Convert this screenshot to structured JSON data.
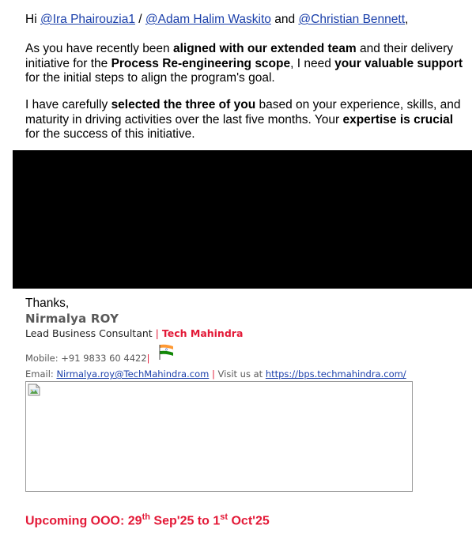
{
  "greeting": {
    "hi": "Hi",
    "mention1": "@Ira Phairouzia1",
    "slash": "/",
    "mention2": "@Adam Halim Waskito",
    "and": "and",
    "mention3": "@Christian Bennett",
    "comma": ","
  },
  "para1": {
    "t1": "As you have recently been ",
    "b1": "aligned with our extended team",
    "t2": " and their delivery initiative for the ",
    "b2": "Process Re-engineering scope",
    "t3": ", I need ",
    "b3": "your valuable support",
    "t4": " for the initial steps to align the program's goal."
  },
  "para2": {
    "t1": "I have carefully ",
    "b1": "selected the three of you",
    "t2": " based on your experience, skills, and maturity in driving activities over the last five months. Your ",
    "b2": "expertise is crucial",
    "t3": " for the success of this initiative."
  },
  "signature": {
    "thanks": "Thanks,",
    "name": "Nirmalya ROY",
    "role": "Lead Business Consultant",
    "separator": "|",
    "company": "Tech Mahindra",
    "mobile_label": "Mobile:",
    "mobile": "+91 9833 60 4422",
    "email_label": "Email:",
    "email": "Nirmalya.roy@TechMahindra.com",
    "visit_label": "Visit us at",
    "website": "https://bps.techmahindra.com/",
    "flag_icon": "india-flag-icon",
    "image_icon": "broken-image-icon"
  },
  "ooo": {
    "prefix": "Upcoming OOO: 29",
    "sup1": "th",
    "mid": " Sep'25 to 1",
    "sup2": "st",
    "suffix": " Oct'25"
  },
  "colors": {
    "link": "#1a3faa",
    "accent_red": "#e31937",
    "name_gray": "#595959"
  }
}
